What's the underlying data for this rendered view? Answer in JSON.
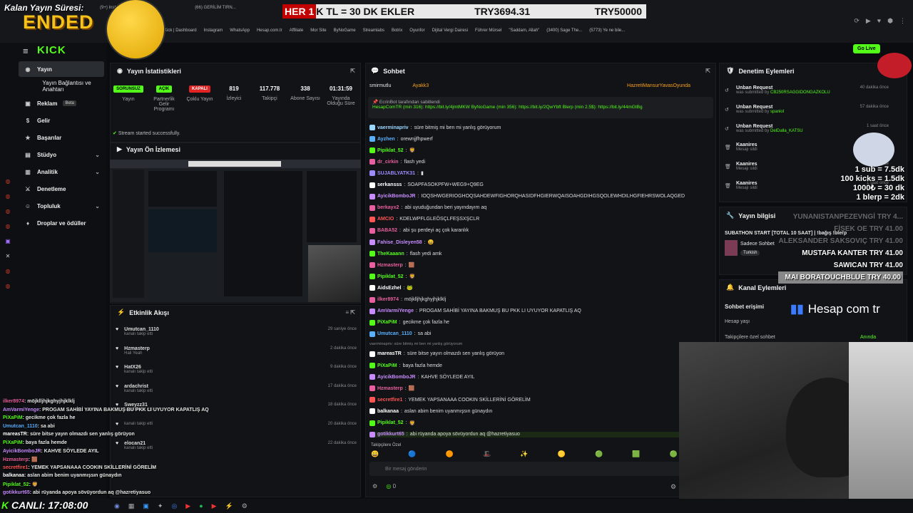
{
  "browser": {
    "tabs": [
      "(9+) Instagram",
      "(66) GERİLİM TIRN..."
    ],
    "bookmarks": [
      "Kick | Dashboard",
      "Instagram",
      "WhatsApp",
      "Hesap.com.tr",
      "Affiliate",
      "Mor Site",
      "ByNoGame",
      "Streamlabs",
      "Botrix",
      "Oyunfor",
      "Dijital Vergi Dairesi",
      "Führer Mürsel",
      "\"Saddam, Allah\"",
      "(3400) Sage The...",
      "(5773) Ye ne bile..."
    ]
  },
  "overlay": {
    "timer_label": "Kalan Yayın Süresi:",
    "ended": "ENDED",
    "donation_prefix": "HER 1",
    "donation_text": "K TL = 30 DK EKLER",
    "amount_current": "TRY3694.31",
    "amount_goal": "TRY50000",
    "live_label": "CANLI: 17:08:00"
  },
  "sidebar": {
    "logo": "KICK",
    "items": [
      {
        "label": "Yayın",
        "icon": "◉"
      },
      {
        "label": "Yayın Bağlantısı ve Anahtarı",
        "icon": ""
      },
      {
        "label": "Reklam",
        "icon": "▣",
        "badge": "Beta"
      },
      {
        "label": "Gelir",
        "icon": "$"
      },
      {
        "label": "Başarılar",
        "icon": "★"
      },
      {
        "label": "Stüdyo",
        "icon": "▤",
        "chev": "⌄"
      },
      {
        "label": "Analitik",
        "icon": "▥",
        "chev": "⌄"
      },
      {
        "label": "Denetleme",
        "icon": "⚔"
      },
      {
        "label": "Topluluk",
        "icon": "☺",
        "chev": "⌄"
      },
      {
        "label": "Droplar ve ödüller",
        "icon": "♦"
      }
    ]
  },
  "stats": {
    "title": "Yayın İstatistikleri",
    "items": [
      {
        "tag": "SORUNSUZ",
        "tag_color": "#53fc18",
        "label": "Yayın"
      },
      {
        "tag": "AÇIK",
        "tag_color": "#53fc18",
        "label": "Partnerlik Gelir Programı"
      },
      {
        "tag": "KAPALI",
        "tag_color": "#e02424",
        "label": "Çoklu Yayın"
      },
      {
        "value": "819",
        "label": "İzleyici"
      },
      {
        "value": "117.778",
        "label": "Takipçi"
      },
      {
        "value": "338",
        "label": "Abone Sayısı"
      },
      {
        "value": "01:31:59",
        "label": "Yayında Olduğu Süre"
      }
    ],
    "status": "Stream started successfully."
  },
  "preview": {
    "title": "Yayın Ön İzlemesi"
  },
  "activity": {
    "title": "Etkinlik Akışı",
    "items": [
      {
        "name": "Umutcan_1110",
        "sub": "kanalı takip etti",
        "time": "29 saniye önce"
      },
      {
        "name": "Hzmasterp",
        "sub": "Hali Yeah",
        "time": "2 dakika önce"
      },
      {
        "name": "HatX26",
        "sub": "kanalı takip etti",
        "time": "9 dakika önce"
      },
      {
        "name": "ardachrist",
        "sub": "kanalı takip etti",
        "time": "17 dakika önce"
      },
      {
        "name": "Sweyzz31",
        "sub": "kanalı takip etti",
        "time": "18 dakika önce"
      },
      {
        "name": "",
        "sub": "kanalı takip etti",
        "time": "20 dakika önce"
      },
      {
        "name": "elocan21",
        "sub": "kanalı takip etti",
        "time": "22 dakika önce"
      }
    ]
  },
  "chat": {
    "title": "Sohbet",
    "top": [
      "smirmutlu",
      "Ayakk3",
      "HazretiMansurYavasOyunda"
    ],
    "pinned_by": "EcrinBot tarafından sabitlendi",
    "pinned_text": "HesapComTR (min 316): https://bit.ly/4jmtMKW ByNoGame (min 356): https://bit.ly/2QwYbft Blerp (min 2.5$): https://bit.ly/44mGtBg",
    "messages": [
      {
        "u": "vaerminapriv",
        "c": "#9bd6ff",
        "t": "süre bitmiş mi ben mi yanlış görüyorum"
      },
      {
        "u": "Ayzhen",
        "c": "#5ab0ff",
        "t": "orewnjjfhpwerf"
      },
      {
        "u": "Pipiklat_52",
        "c": "#53fc18",
        "t": "🦁"
      },
      {
        "u": "dr_cirkin",
        "c": "#e85f9f",
        "t": "flash yedi"
      },
      {
        "u": "SUJABLYATK31",
        "c": "#9b8cff",
        "t": "▮"
      },
      {
        "u": "serkansss",
        "c": "#fff",
        "t": "SOAPFASOKPFW+WEG9+Q9EG"
      },
      {
        "u": "AyicikBomboJR",
        "c": "#c88cff",
        "t": "IOQSHWGERIOGHOQSAHDEWFIGHORQHASIDFHGIERWQAISOAHGDIHGSQOLEWHDILHGFIEHRSWOLAQGED"
      },
      {
        "u": "berkayx2",
        "c": "#e85f9f",
        "t": "abi uyuduğundan beri yayındayım aq"
      },
      {
        "u": "AMCIO",
        "c": "#ff5555",
        "t": "KDELWPFLGLEÖSÇLFEŞSXŞCLR"
      },
      {
        "u": "BABA52",
        "c": "#e85f9f",
        "t": "abi şu perdeyi aç çok karanlık"
      },
      {
        "u": "Fahise_Disleyen58",
        "c": "#c88cff",
        "t": "😀"
      },
      {
        "u": "TheKaaann",
        "c": "#53fc18",
        "t": "flash yedi amk"
      },
      {
        "u": "Hzmasterp",
        "c": "#e85f9f",
        "t": "🟫"
      },
      {
        "u": "Pipiklat_52",
        "c": "#53fc18",
        "t": "🦁"
      },
      {
        "u": "AidsEzhel",
        "c": "#fff",
        "t": "🐸"
      },
      {
        "u": "ilker8974",
        "c": "#e85f9f",
        "t": "möjklljhjkghyjhjklklj"
      },
      {
        "u": "AmVarmiYenge",
        "c": "#c88cff",
        "t": "PROGAM SAHİBİ YAYINA BAKMUŞ BU PKK LI UYUYOR KAPATLIŞ AQ"
      },
      {
        "u": "PiXaPiM",
        "c": "#53fc18",
        "t": "gecikme çok fazla he"
      },
      {
        "u": "Umutcan_1110",
        "c": "#5ab0ff",
        "t": "sa abi"
      },
      {
        "u": "mareasTR",
        "c": "#fff",
        "t": "süre bitse yayın olmazdı sen yanlış görüyon"
      },
      {
        "u": "PiXaPiM",
        "c": "#53fc18",
        "t": "baya fazla hemde"
      },
      {
        "u": "AyicikBomboJR",
        "c": "#c88cff",
        "t": "KAHVE SÖYLEDE AYIL"
      },
      {
        "u": "Hzmasterp",
        "c": "#e85f9f",
        "t": "🟫"
      },
      {
        "u": "secretfire1",
        "c": "#ff5555",
        "t": "YEMEK YAPSANAAA COOKIN SKİLLERİNİ GÖRELİM"
      },
      {
        "u": "balkanaa",
        "c": "#fff",
        "t": "aslan abim benim uyanmışsın günaydın"
      },
      {
        "u": "Pipiklat_52",
        "c": "#53fc18",
        "t": "🦁"
      },
      {
        "u": "gotikkurt65",
        "c": "#c88cff",
        "t": "abi rüyanda apoya sövüyordun aq @hazretiyasuo"
      }
    ],
    "system_note": "vaerminapriv: süre bitmiş mi ben mi yanlış görüyorum",
    "followers_label": "Takipçilere Özel",
    "input_placeholder": "Bir mesaj gönderin",
    "count": "0"
  },
  "mod": {
    "title": "Denetim Eylemleri",
    "items": [
      {
        "a": "Unban Request",
        "s": "was submitted by",
        "u": "CB250RSAGGIDONGAZKOLU",
        "t": "40 dakika önce"
      },
      {
        "a": "Unban Request",
        "s": "was submitted by",
        "u": "spaniol",
        "t": "57 dakika önce"
      },
      {
        "a": "Unban Request",
        "s": "was submitted by",
        "u": "DelDalla_KATSU",
        "t": "1 saat önce"
      },
      {
        "a": "Kaanires",
        "s": "Mesajı sildi",
        "u": "",
        "t": "1 saat önce"
      },
      {
        "a": "Kaanires",
        "s": "Mesajı sildi",
        "u": "",
        "t": "1 saat önce"
      },
      {
        "a": "Kaanires",
        "s": "Mesajı sildi",
        "u": "",
        "t": "1 saat önce"
      }
    ]
  },
  "info": {
    "title": "Yayın bilgisi",
    "stream_title": "SUBATHON START [TOTAL 10 SAAT] | !bağış !blerp",
    "category": "Sadece Sohbet",
    "lang": "Turkish"
  },
  "channel": {
    "title": "Kanal Eylemleri",
    "access": "Sohbet erişimi",
    "account": "Hesap yaşı",
    "followers": "Takipçilere özel sohbet",
    "followers_value": "Anında"
  },
  "goals": [
    "1 sub = 7.5dk",
    "100 kicks = 1.5dk",
    "1000₺ = 30 dk",
    "1 blerp = 2dk"
  ],
  "top_donations": [
    {
      "n": "YUNANISTANPEZEVNGİ",
      "a": "TRY 4..."
    },
    {
      "n": "FİŞEK OE",
      "a": "TRY 41.00"
    },
    {
      "n": "ALEKSANDER SAKSOVIÇ",
      "a": "TRY 41.00"
    },
    {
      "n": "MUSTAFA KANTER",
      "a": "TRY 41.00"
    },
    {
      "n": "SAWICAN",
      "a": "TRY 41.00"
    },
    {
      "n": "MAI BORATOUCHBLUE",
      "a": "TRY 40.00"
    }
  ],
  "hesap_logo": "Hesap com tr",
  "golive": "Go Live",
  "overlay_chat": [
    {
      "u": "ilker8974",
      "c": "#e85f9f",
      "t": "möjklljhjkghyjhjklklj"
    },
    {
      "u": "AmVarmiYenge",
      "c": "#c88cff",
      "t": "PROGAM SAHİBİ YAYINA BAKMUŞ BU PKK LI UYUYOR KAPATLIŞ AQ"
    },
    {
      "u": "PiXaPiM",
      "c": "#53fc18",
      "t": "gecikme çok fazla he"
    },
    {
      "u": "Umutcan_1110",
      "c": "#5ab0ff",
      "t": "sa abi"
    },
    {
      "u": "mareasTR",
      "c": "#fff",
      "t": "süre bitse yayın olmazdı sen yanlış görüyon"
    },
    {
      "u": "PiXaPiM",
      "c": "#53fc18",
      "t": "baya fazla hemde"
    },
    {
      "u": "AyicikBomboJR",
      "c": "#c88cff",
      "t": "KAHVE SÖYLEDE AYIL"
    },
    {
      "u": "Hzmasterp",
      "c": "#e85f9f",
      "t": "🟫"
    },
    {
      "u": "secretfire1",
      "c": "#ff5555",
      "t": "YEMEK YAPSANAAA COOKIN SKİLLERİNİ GÖRELİM"
    },
    {
      "u": "balkanaa",
      "c": "#fff",
      "t": "aslan abim benim uyanmışsın günaydın"
    },
    {
      "u": "Pipiklat_52",
      "c": "#53fc18",
      "t": "🦁"
    },
    {
      "u": "gotikkurt65",
      "c": "#c88cff",
      "t": "abi rüyanda apoya sövüyordun aq @hazretiyasuo"
    }
  ]
}
